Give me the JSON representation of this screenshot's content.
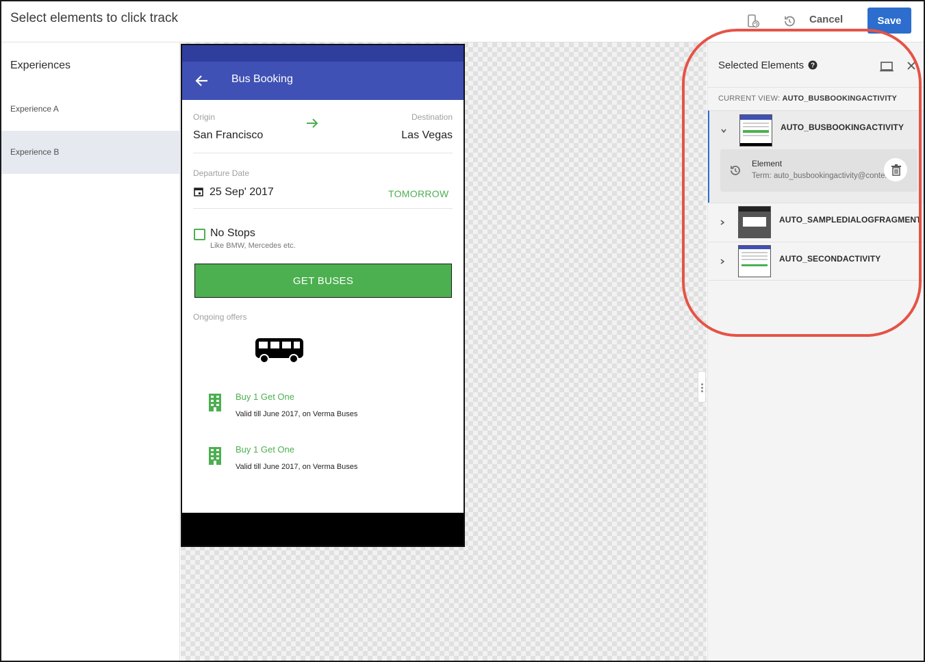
{
  "header": {
    "title": "Select elements to click track",
    "cancel_label": "Cancel",
    "save_label": "Save"
  },
  "experiences": {
    "heading": "Experiences",
    "items": [
      {
        "label": "Experience A",
        "selected": false
      },
      {
        "label": "Experience B",
        "selected": true
      }
    ]
  },
  "phone": {
    "app_title": "Bus Booking",
    "origin_label": "Origin",
    "origin_value": "San Francisco",
    "destination_label": "Destination",
    "destination_value": "Las Vegas",
    "departure_label": "Departure Date",
    "departure_value": "25 Sep' 2017",
    "tomorrow_label": "TOMORROW",
    "no_stops_label": "No Stops",
    "no_stops_sub": "Like BMW, Mercedes etc.",
    "get_buses_label": "GET BUSES",
    "offers_label": "Ongoing offers",
    "offers": [
      {
        "title": "Buy 1 Get One",
        "subtitle": "Valid till June 2017, on Verma Buses"
      },
      {
        "title": "Buy 1 Get One",
        "subtitle": "Valid till June 2017, on Verma Buses"
      }
    ]
  },
  "selected_panel": {
    "title": "Selected Elements",
    "current_view_label": "CURRENT VIEW:",
    "current_view_value": "AUTO_BUSBOOKINGACTIVITY",
    "views": [
      {
        "name": "AUTO_BUSBOOKINGACTIVITY",
        "expanded": true
      },
      {
        "name": "AUTO_SAMPLEDIALOGFRAGMENT",
        "expanded": false
      },
      {
        "name": "AUTO_SECONDACTIVITY",
        "expanded": false
      }
    ],
    "element": {
      "title": "Element",
      "term": "Term: auto_busbookingactivity@content"
    }
  },
  "colors": {
    "primary": "#2c6dcd",
    "app_bar": "#3f51b5",
    "accent_green": "#4caf50",
    "callout": "#e55347"
  }
}
